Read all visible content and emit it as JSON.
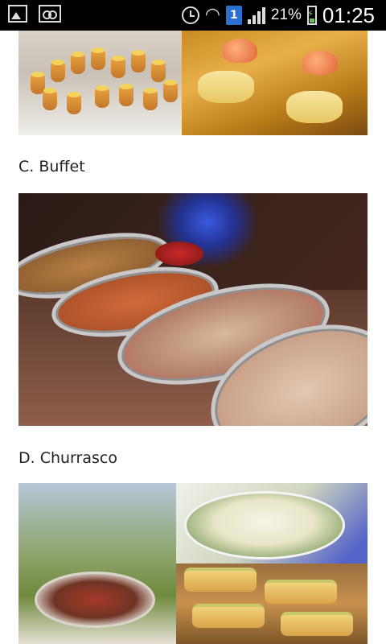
{
  "status_bar": {
    "left_icons": [
      "gallery-icon",
      "voicemail-icon"
    ],
    "right_icons": [
      "alarm-icon",
      "wifi-icon",
      "sim-badge",
      "signal-icon",
      "battery-icon"
    ],
    "sim_number": "1",
    "battery_percent": "21%",
    "time": "01:25"
  },
  "content": {
    "sections": [
      {
        "heading": "C. Buffet"
      },
      {
        "heading": "D. Churrasco"
      }
    ]
  },
  "colors": {
    "status_bar_bg": "#000000",
    "page_bg": "#ffffff",
    "heading_text": "#222222",
    "sim_badge": "#2b6fd0"
  }
}
